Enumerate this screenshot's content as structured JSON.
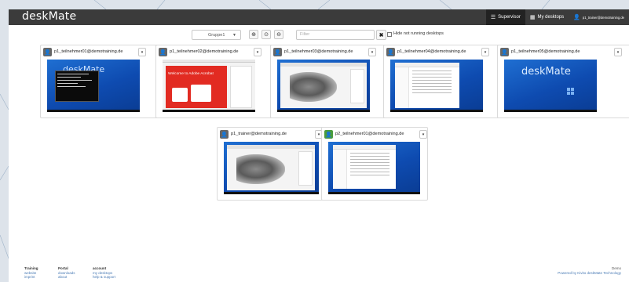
{
  "app": {
    "brand": "deskMate",
    "nav": [
      {
        "icon": "list-icon",
        "label": "Supervisor",
        "active": true
      },
      {
        "icon": "grid-icon",
        "label": "My desktops",
        "active": false
      },
      {
        "icon": "user-icon",
        "label": "p1_trainer@demotraining.de",
        "active": false
      }
    ]
  },
  "toolbar": {
    "group_select": "Gruppe1",
    "filter_placeholder": "Filter",
    "clear_label": "✖",
    "hide_not_running_label": "Hide not running desktops",
    "hide_not_running_checked": false
  },
  "desktops": [
    {
      "user": "p1_teilnehmer01@demotraining.de",
      "status_color": "#666666",
      "screen": "console"
    },
    {
      "user": "p1_teilnehmer02@demotraining.de",
      "status_color": "#666666",
      "screen": "acrobat"
    },
    {
      "user": "p1_teilnehmer03@demotraining.de",
      "status_color": "#666666",
      "screen": "engine"
    },
    {
      "user": "p1_teilnehmer04@demotraining.de",
      "status_color": "#666666",
      "screen": "explorer"
    },
    {
      "user": "p1_teilnehmer05@demotraining.de",
      "status_color": "#666666",
      "screen": "desktop"
    },
    {
      "user": "p1_trainer@demotraining.de",
      "status_color": "#666666",
      "screen": "engine"
    },
    {
      "user": "p2_teilnehmer01@demotraining.de",
      "status_color": "#4a9c3e",
      "screen": "explorer"
    }
  ],
  "screens": {
    "dm_wordmark": "deskMate",
    "acrobat_banner": "Welcome to Adobe Acrobat"
  },
  "footer": {
    "columns": [
      {
        "heading": "Training",
        "links": [
          "website",
          "imprint"
        ]
      },
      {
        "heading": "Portal",
        "links": [
          "downloads",
          "about"
        ]
      },
      {
        "heading": "account",
        "links": [
          "my desktops",
          "help & support"
        ]
      }
    ],
    "right_top": "Demo",
    "powered": "Powered by Kivito deskMate Technology"
  }
}
